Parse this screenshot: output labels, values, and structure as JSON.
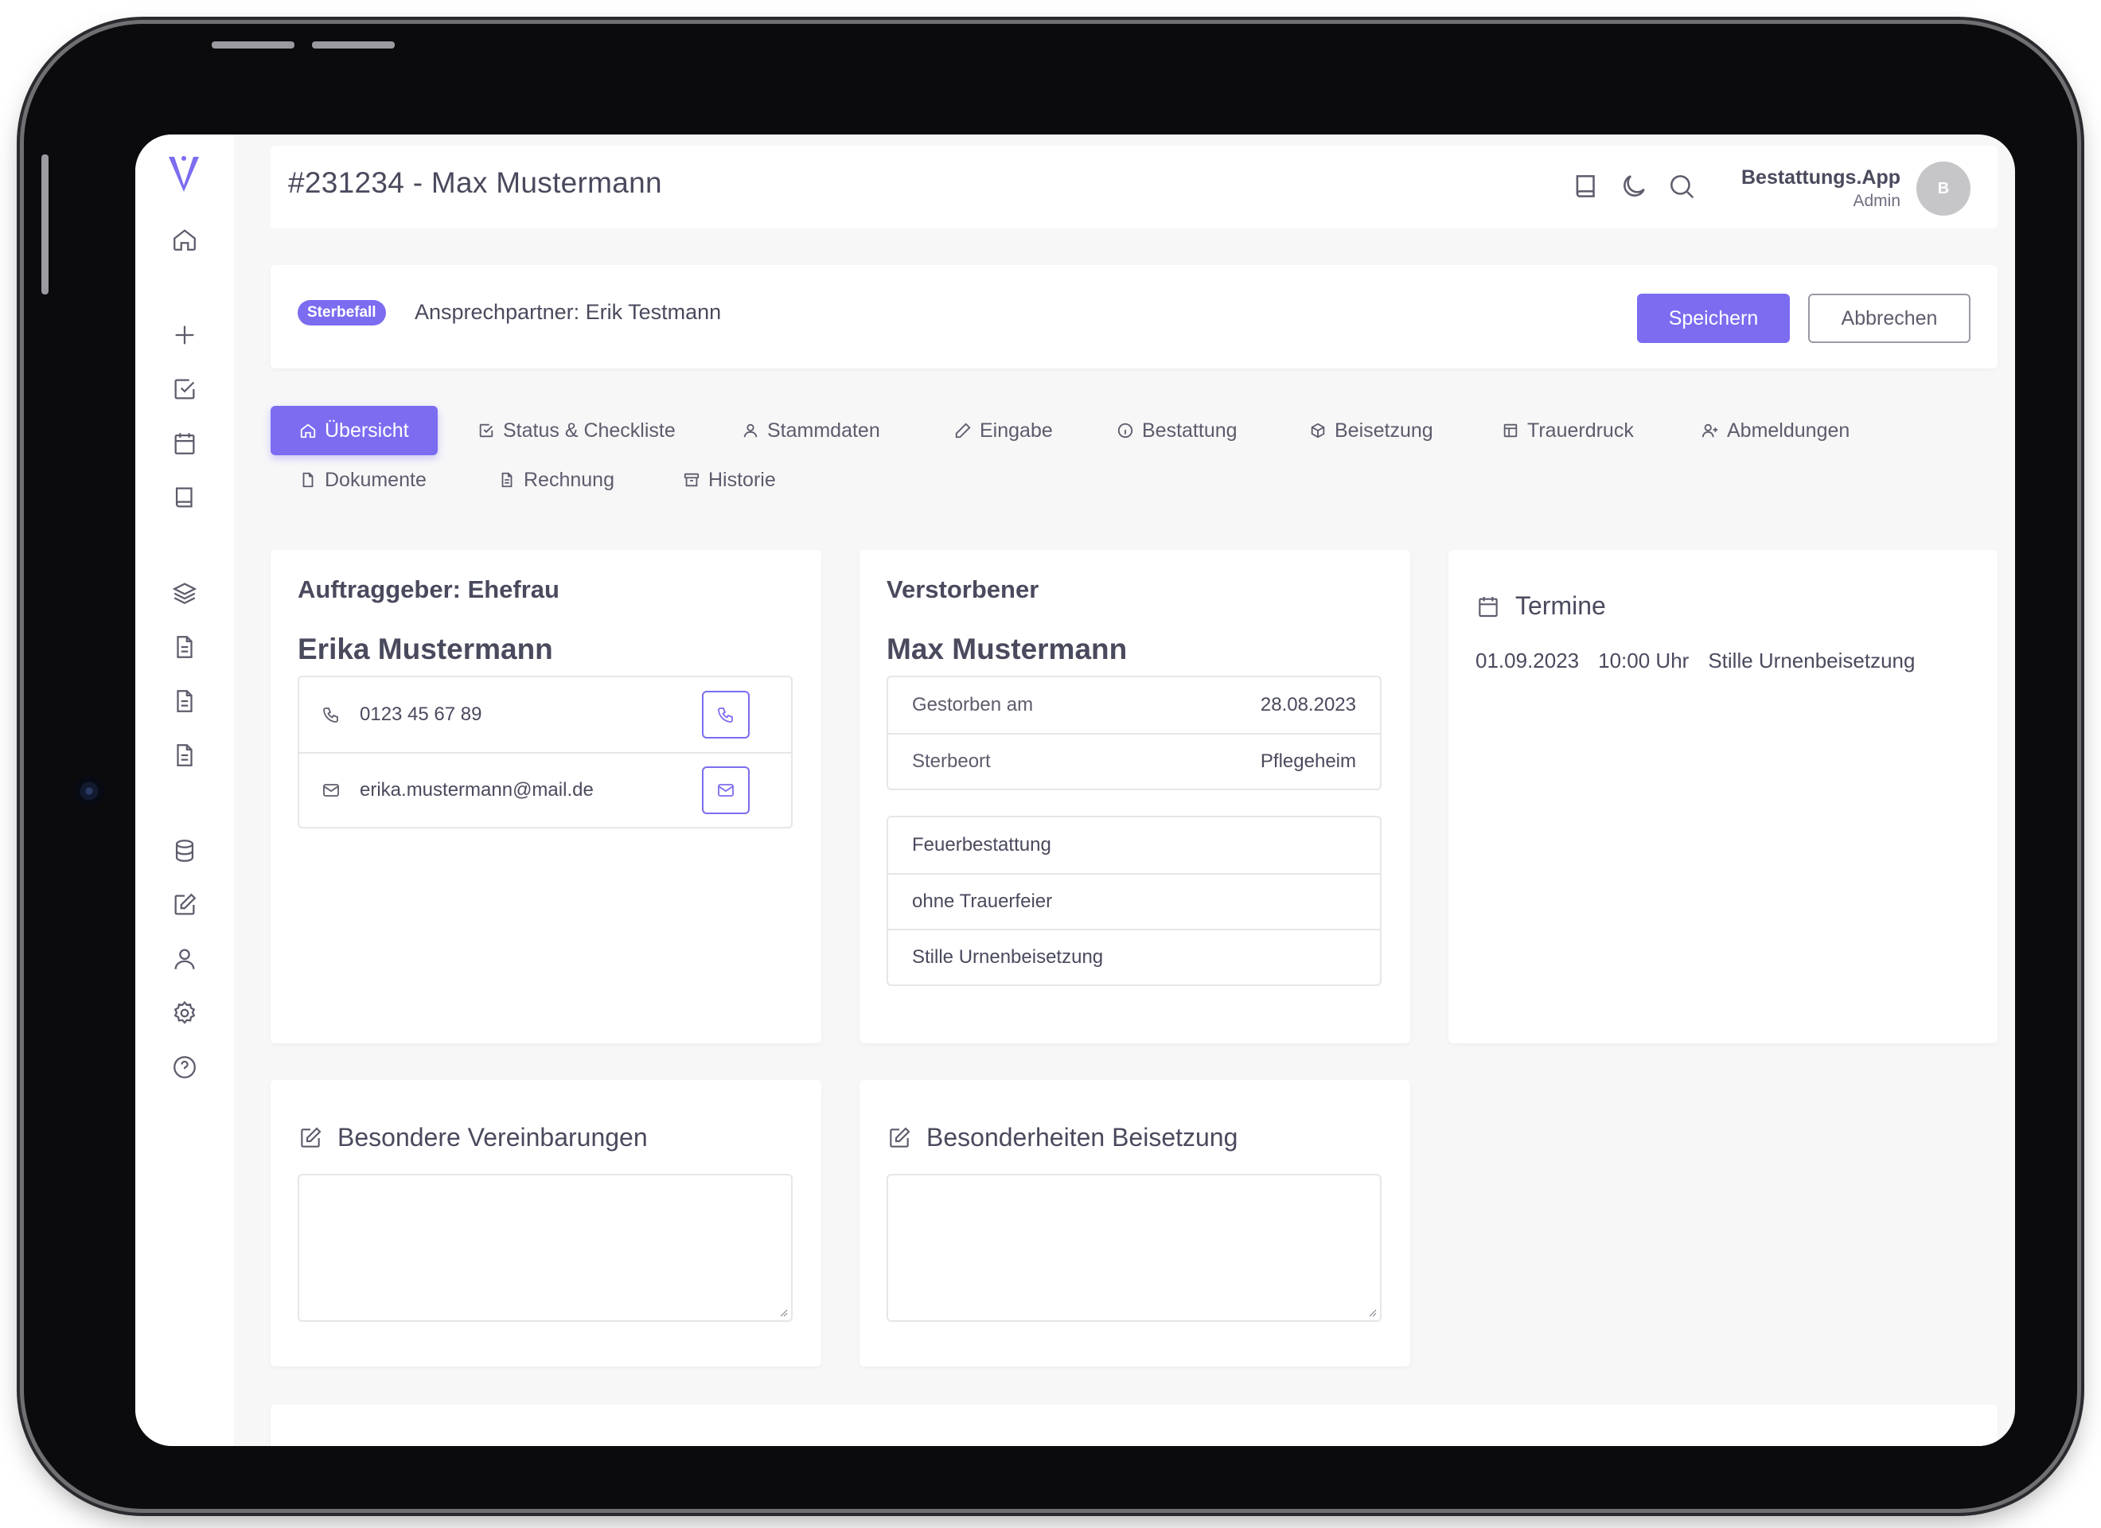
{
  "header": {
    "title": "#231234 - Max Mustermann",
    "user_name": "Bestattungs.App",
    "user_role": "Admin",
    "avatar_initial": "B"
  },
  "case": {
    "badge": "Sterbefall",
    "contact": "Ansprechpartner: Erik Testmann",
    "save_label": "Speichern",
    "cancel_label": "Abbrechen"
  },
  "tabs": [
    {
      "label": "Übersicht",
      "icon": "home-icon",
      "active": true
    },
    {
      "label": "Status & Checkliste",
      "icon": "checkbox-icon"
    },
    {
      "label": "Stammdaten",
      "icon": "user-icon"
    },
    {
      "label": "Eingabe",
      "icon": "pencil-icon"
    },
    {
      "label": "Bestattung",
      "icon": "info-icon"
    },
    {
      "label": "Beisetzung",
      "icon": "cube-icon"
    },
    {
      "label": "Trauerdruck",
      "icon": "layout-icon"
    },
    {
      "label": "Abmeldungen",
      "icon": "user-plus-icon"
    },
    {
      "label": "Dokumente",
      "icon": "file-icon"
    },
    {
      "label": "Rechnung",
      "icon": "file-text-icon"
    },
    {
      "label": "Historie",
      "icon": "archive-icon"
    }
  ],
  "auftraggeber": {
    "heading": "Auftraggeber: Ehefrau",
    "name": "Erika Mustermann",
    "phone": "0123 45 67 89",
    "email": "erika.mustermann@mail.de"
  },
  "verstorbener": {
    "heading": "Verstorbener",
    "name": "Max Mustermann",
    "details": [
      {
        "label": "Gestorben am",
        "value": "28.08.2023"
      },
      {
        "label": "Sterbeort",
        "value": "Pflegeheim"
      }
    ],
    "options": [
      "Feuerbestattung",
      "ohne Trauerfeier",
      "Stille Urnenbeisetzung"
    ]
  },
  "termine": {
    "heading": "Termine",
    "items": [
      {
        "date": "01.09.2023",
        "time": "10:00 Uhr",
        "title": "Stille Urnenbeisetzung"
      }
    ]
  },
  "notes": {
    "vereinbarungen_heading": "Besondere Vereinbarungen",
    "beisetzung_heading": "Besonderheiten Beisetzung"
  },
  "colors": {
    "accent": "#7b6cf0",
    "background": "#f7f7f8",
    "text": "#4a4a5e"
  }
}
